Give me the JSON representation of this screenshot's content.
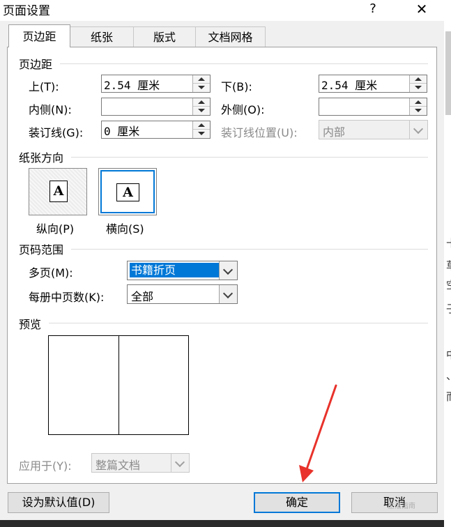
{
  "window": {
    "title": "页面设置",
    "help": "?",
    "close": "✕"
  },
  "tabs": [
    {
      "label": "页边距",
      "active": true
    },
    {
      "label": "纸张",
      "active": false
    },
    {
      "label": "版式",
      "active": false
    },
    {
      "label": "文档网格",
      "active": false
    }
  ],
  "margins": {
    "group_label": "页边距",
    "top_label": "上(T):",
    "top_value": "2.54 厘米",
    "bottom_label": "下(B):",
    "bottom_value": "2.54 厘米",
    "inside_label": "内侧(N):",
    "inside_value": "",
    "outside_label": "外侧(O):",
    "outside_value": "",
    "gutter_label": "装订线(G):",
    "gutter_value": "0 厘米",
    "gutter_pos_label": "装订线位置(U):",
    "gutter_pos_value": "内部"
  },
  "orientation": {
    "group_label": "纸张方向",
    "portrait_label": "纵向(P)",
    "landscape_label": "横向(S)",
    "icon_letter": "A",
    "selected": "landscape"
  },
  "pages": {
    "group_label": "页码范围",
    "multiple_label": "多页(M):",
    "multiple_value": "书籍折页",
    "sheets_label": "每册中页数(K):",
    "sheets_value": "全部"
  },
  "preview": {
    "group_label": "预览",
    "apply_label": "应用于(Y):",
    "apply_value": "整篇文档"
  },
  "buttons": {
    "default": "设为默认值(D)",
    "ok": "确定",
    "cancel": "取消"
  },
  "side_chars": [
    "十",
    "草",
    "空",
    "子",
    "中",
    "、",
    "而"
  ],
  "watermark": "生活指南",
  "colors": {
    "accent": "#0078d7",
    "annotation_arrow": "#e8322b"
  }
}
